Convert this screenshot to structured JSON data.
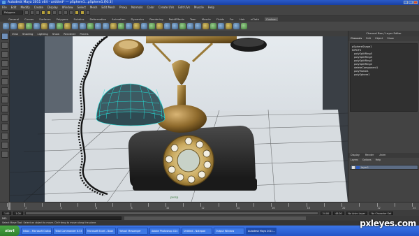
{
  "window": {
    "title": "Autodesk Maya 2011 x64 - untitled*   ---   pSphere1...pSphere1.f[0:3]"
  },
  "menubar": [
    "File",
    "Edit",
    "Modify",
    "Create",
    "Display",
    "Window",
    "Select",
    "Mesh",
    "Edit Mesh",
    "Proxy",
    "Normals",
    "Color",
    "Create UVs",
    "Edit UVs",
    "Muscle",
    "Help"
  ],
  "statusline": {
    "mode": "Polygons"
  },
  "shelf": {
    "tabs": [
      "General",
      "Curves",
      "Surfaces",
      "Polygons",
      "Subdivs",
      "Deformation",
      "Animation",
      "Dynamics",
      "Rendering",
      "PaintEffects",
      "Toon",
      "Muscle",
      "Fluids",
      "Fur",
      "Hair",
      "nCloth",
      "Custom"
    ],
    "active": "Custom"
  },
  "panel_menu": [
    "View",
    "Shading",
    "Lighting",
    "Show",
    "Renderer",
    "Panels"
  ],
  "viewport": {
    "camera_label": "persp"
  },
  "channel_box": {
    "title": "Channel Box / Layer Editor",
    "tabs": [
      "Channels",
      "Edit",
      "Object",
      "Show"
    ],
    "items": [
      {
        "text": "pSphereShape1",
        "indent": false
      },
      {
        "text": "INPUTS",
        "indent": false
      },
      {
        "text": "polySplitRing5",
        "indent": true
      },
      {
        "text": "polySplitRing4",
        "indent": true
      },
      {
        "text": "polySplitRing3",
        "indent": true
      },
      {
        "text": "polySplitRing2",
        "indent": true
      },
      {
        "text": "deleteComponent1",
        "indent": true
      },
      {
        "text": "polyTweak1",
        "indent": true
      },
      {
        "text": "polySphere1",
        "indent": true
      }
    ]
  },
  "layer_editor": {
    "tabs": [
      "Display",
      "Render",
      "Anim"
    ],
    "menu": [
      "Layers",
      "Options",
      "Help"
    ],
    "layers": [
      {
        "name": "layer1"
      }
    ]
  },
  "timeline": {
    "labels": [
      "1",
      "2",
      "4",
      "6",
      "8",
      "10",
      "12",
      "14",
      "16",
      "18",
      "20",
      "22",
      "24"
    ]
  },
  "range": {
    "start": "1.00",
    "start2": "1.00",
    "end": "24.00",
    "end2": "48.00",
    "anim_layer": "No Anim Layer",
    "char": "No Character Set"
  },
  "command": {
    "label": "MEL"
  },
  "help_line": "Select Move Tool: Select an object to move. Ctrl+drag to move along the plane.",
  "taskbar": {
    "start": "start",
    "tasks": [
      "Inbox - Microsoft Outlook",
      "Total Commander 6.53",
      "Microsoft Excel - Book",
      "Yahoo! Messenger",
      "Adobe Photoshop CS4",
      "Untitled - Notepad",
      "Output Window",
      "Autodesk Maya 2011..."
    ],
    "active_index": 7
  },
  "watermark": "pxleyes.com",
  "colors": {
    "taskbar": "#2455c7",
    "start": "#3a9b35",
    "wireframe": "#22e0d8"
  }
}
